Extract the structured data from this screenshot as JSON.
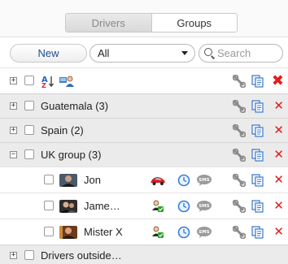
{
  "tabs": [
    {
      "label": "Drivers",
      "active": false
    },
    {
      "label": "Groups",
      "active": true
    }
  ],
  "toolbar": {
    "new_label": "New",
    "filter_value": "All",
    "search_placeholder": "Search"
  },
  "groups": [
    {
      "name": "Guatemala (3)",
      "expander": "+"
    },
    {
      "name": "Spain (2)",
      "expander": "+"
    },
    {
      "name": "UK group (3)",
      "expander": "−"
    }
  ],
  "drivers": [
    {
      "name": "Jon",
      "vehicle_icon": "red-car-icon"
    },
    {
      "name": "Jame…",
      "vehicle_icon": "driver-assigned-icon"
    },
    {
      "name": "Mister X",
      "vehicle_icon": "driver-assigned-icon"
    }
  ],
  "outside_group": {
    "name": "Drivers outside…",
    "expander": "+"
  },
  "colors": {
    "delete": "#e81a1a",
    "link": "#1f4f8e",
    "group_bg": "#ebebeb",
    "clock": "#3a7fd5"
  }
}
